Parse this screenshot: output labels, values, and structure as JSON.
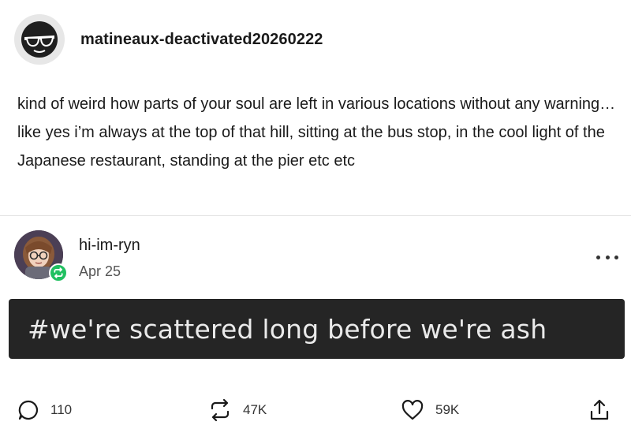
{
  "op": {
    "username": "matineaux-deactivated20260222",
    "body": "kind of weird how parts of your soul are left in various locations without any warning… like yes i’m always at the top of that hill, sitting at the bus stop, in the cool light of the Japanese restaurant, standing at the pier etc etc"
  },
  "reblog": {
    "username": "hi-im-ryn",
    "date": "Apr 25",
    "tag": "#we're scattered long before we're ash"
  },
  "footer": {
    "replies": "110",
    "reblogs": "47K",
    "likes": "59K"
  },
  "icons": {
    "op_avatar": "sunglasses-icon",
    "reblog_badge": "reblog-icon",
    "more": "more-options-icon",
    "reply": "reply-icon",
    "reblog": "reblog-icon",
    "like": "heart-icon",
    "share": "share-icon"
  },
  "colors": {
    "reblog_badge": "#21c061",
    "tag_background": "#252525",
    "tag_text": "#eaeaea"
  }
}
